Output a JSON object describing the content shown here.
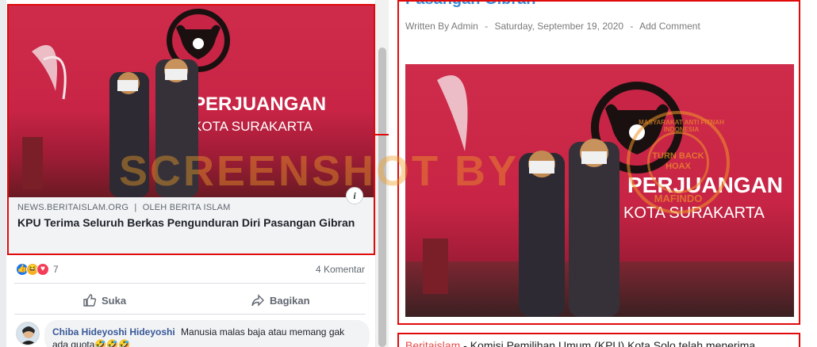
{
  "fb_post": {
    "link_domain": "NEWS.BERITAISLAM.ORG",
    "link_sep": "|",
    "link_author": "OLEH BERITA ISLAM",
    "link_title": "KPU Terima Seluruh Berkas Pengunduran Diri Pasangan Gibran",
    "info_glyph": "i",
    "reaction_count": "7",
    "comments_count": "4 Komentar",
    "like_label": "Suka",
    "share_label": "Bagikan",
    "comment": {
      "author": "Chiba Hideyoshi Hideyoshi",
      "text": "Manusia malas baja atau memang gak ada quota🤣🤣🤣"
    },
    "banner_text_1": "PERJUANGAN",
    "banner_text_2": "KOTA SURAKARTA"
  },
  "article": {
    "title": "Pasangan Gibran",
    "meta_author": "Written By Admin",
    "meta_sep": "-",
    "meta_date": "Saturday, September 19, 2020",
    "meta_comment": "Add Comment",
    "body_source": "Beritaislam",
    "body_text": " - Komisi Pemilihan Umum (KPU) Kota Solo telah menerima",
    "banner_text_1": "PERJUANGAN",
    "banner_text_2": "KOTA SURAKARTA",
    "stamp_text": "TURN BACK HOAX",
    "stamp_ring_top": "MASYARAKAT ANTI FITNAH INDONESIA",
    "stamp_ring_bottom": "MAFINDO"
  },
  "watermark": "SCREENSHOT BY",
  "colors": {
    "highlight_red": "#e10a0a",
    "fb_link_blue": "#385898",
    "article_title_blue": "#3a8ad6",
    "wall_red": "#c82445"
  }
}
